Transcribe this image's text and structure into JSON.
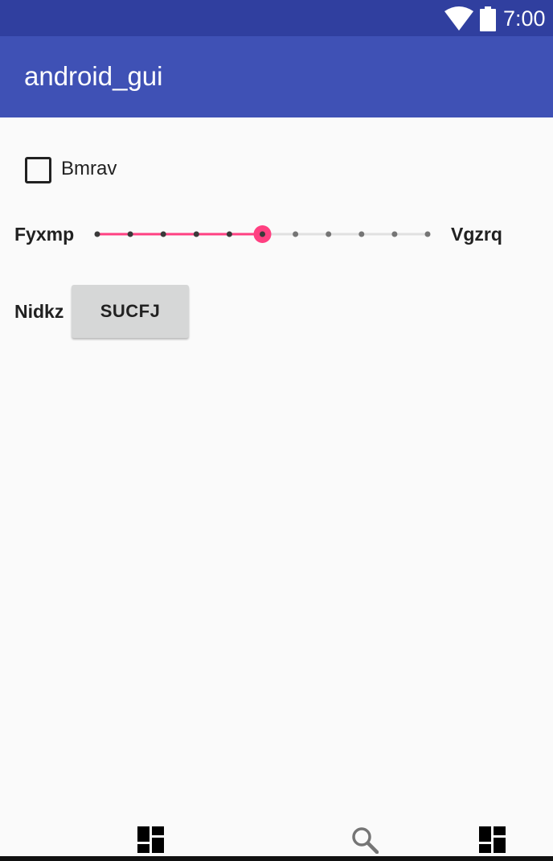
{
  "status_bar": {
    "time": "7:00",
    "icons": [
      "wifi-icon",
      "battery-icon"
    ],
    "color": "#303f9f"
  },
  "app_bar": {
    "title": "android_gui",
    "color": "#3f51b5"
  },
  "checkbox": {
    "label": "Bmrav",
    "checked": false
  },
  "slider": {
    "left_label": "Fyxmp",
    "right_label": "Vgzrq",
    "min": 0,
    "max": 10,
    "value": 5,
    "accent": "#ff4081"
  },
  "button_row": {
    "label": "Nidkz",
    "button_label": "SUCFJ"
  },
  "bottom_icons": [
    "dashboard-icon",
    "search-icon",
    "dashboard-icon"
  ]
}
